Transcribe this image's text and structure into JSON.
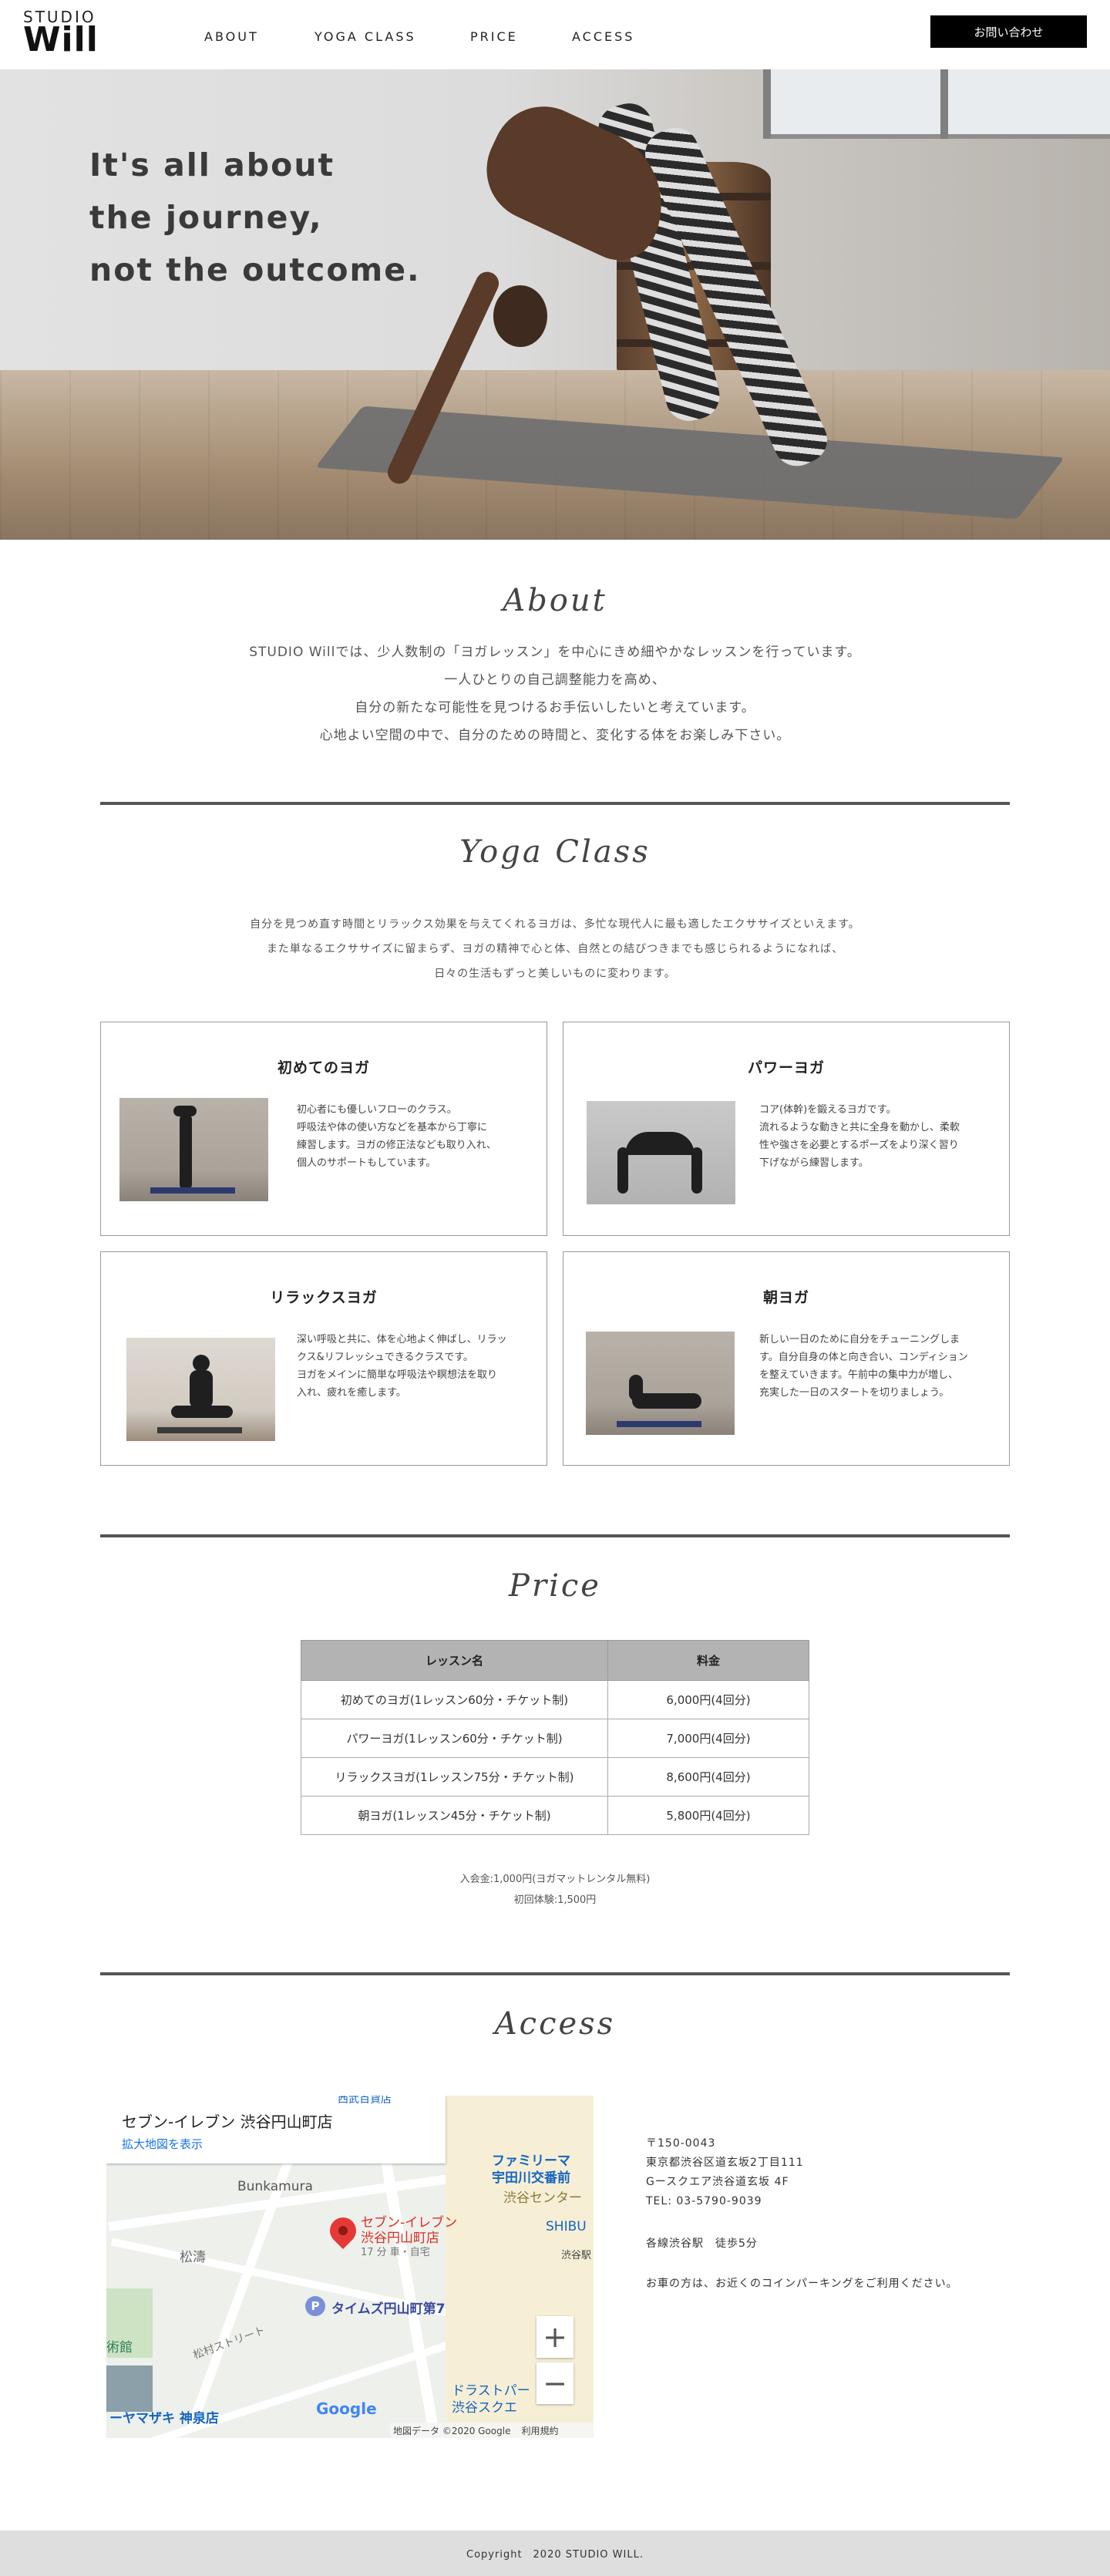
{
  "header": {
    "logo_top": "STUDIO",
    "logo_main": "Will",
    "nav": [
      "ABOUT",
      "YOGA CLASS",
      "PRICE",
      "ACCESS"
    ],
    "contact_button": "お問い合わせ"
  },
  "hero": {
    "lines": [
      "It's all about",
      "the journey,",
      "not the outcome."
    ]
  },
  "about": {
    "heading": "About",
    "lines": [
      "STUDIO Willでは、少人数制の「ヨガレッスン」を中心にきめ細やかなレッスンを行っています。",
      "一人ひとりの自己調整能力を高め、",
      "自分の新たな可能性を見つけるお手伝いしたいと考えています。",
      "心地よい空間の中で、自分のための時間と、変化する体をお楽しみ下さい。"
    ]
  },
  "yoga": {
    "heading": "Yoga Class",
    "lines": [
      "自分を見つめ直す時間とリラックス効果を与えてくれるヨガは、多忙な現代人に最も適したエクササイズといえます。",
      "また単なるエクササイズに留まらず、ヨガの精神で心と体、自然との結びつきまでも感じられるようになれば、",
      "日々の生活もずっと美しいものに変わります。"
    ],
    "cards": [
      {
        "title": "初めてのヨガ",
        "desc": [
          "初心者にも優しいフローのクラス。",
          "呼吸法や体の使い方などを基本から丁寧に",
          "練習します。ヨガの修正法なども取り入れ、",
          "個人のサポートもしています。"
        ]
      },
      {
        "title": "パワーヨガ",
        "desc": [
          "コア(体幹)を鍛えるヨガです。",
          "流れるような動きと共に全身を動かし、柔軟",
          "性や強さを必要とするポーズをより深く習り",
          "下げながら練習します。"
        ]
      },
      {
        "title": "リラックスヨガ",
        "desc": [
          "深い呼吸と共に、体を心地よく伸ばし、リラッ",
          "クス&リフレッシュできるクラスです。",
          "ヨガをメインに簡単な呼吸法や瞑想法を取り",
          "入れ、疲れを癒します。"
        ]
      },
      {
        "title": "朝ヨガ",
        "desc": [
          "新しい一日のために自分をチューニングしま",
          "す。自分自身の体と向き合い、コンディション",
          "を整えていきます。午前中の集中力が増し、",
          "充実した一日のスタートを切りましょう。"
        ]
      }
    ]
  },
  "price": {
    "heading": "Price",
    "columns": [
      "レッスン名",
      "料金"
    ],
    "rows": [
      [
        "初めてのヨガ(1レッスン60分・チケット制)",
        "6,000円(4回分)"
      ],
      [
        "パワーヨガ(1レッスン60分・チケット制)",
        "7,000円(4回分)"
      ],
      [
        "リラックスヨガ(1レッスン75分・チケット制)",
        "8,600円(4回分)"
      ],
      [
        "朝ヨガ(1レッスン45分・チケット制)",
        "5,800円(4回分)"
      ]
    ],
    "notes": [
      "入会金:1,000円(ヨガマットレンタル無料)",
      "初回体験:1,500円"
    ]
  },
  "access": {
    "heading": "Access",
    "map": {
      "place_name": "セブン-イレブン 渋谷円山町店",
      "enlarge_link": "拡大地図を表示",
      "pin_label_1": "セブン-イレブン",
      "pin_label_2": "渋谷円山町店",
      "pin_sub": "17 分 車・自宅",
      "labels": {
        "bunkamura": "Bunkamura",
        "family": "ファミリーマ",
        "family2": "宇田川交番前",
        "shibuya_center": "渋谷センター",
        "shibu": "SHIBU",
        "shibuya_ekimae": "渋谷駅",
        "matsunami": "松濤",
        "times": "タイムズ円山町第7",
        "bijutsukan": "術館",
        "street": "松村ストリート",
        "yamazaki": "ーヤマザキ 神泉店",
        "dotrust": "ドラストパー",
        "shibuya_square": "渋谷スクエ",
        "google": "Google",
        "attribution": "地図データ ©2020 Google",
        "terms": "利用規約",
        "top_label": "西武百貨店"
      },
      "zoom_in": "+",
      "zoom_out": "−"
    },
    "address_lines": [
      "〒150-0043",
      "東京都渋谷区道玄坂2丁目111",
      "Gースクエア渋谷道玄坂 4F",
      "TEL: 03-5790-9039"
    ],
    "station": "各線渋谷駅　徒歩5分",
    "parking": "お車の方は、お近くのコインパーキングをご利用ください。"
  },
  "footer": {
    "copyright": "Copyright　2020 STUDIO WILL."
  }
}
